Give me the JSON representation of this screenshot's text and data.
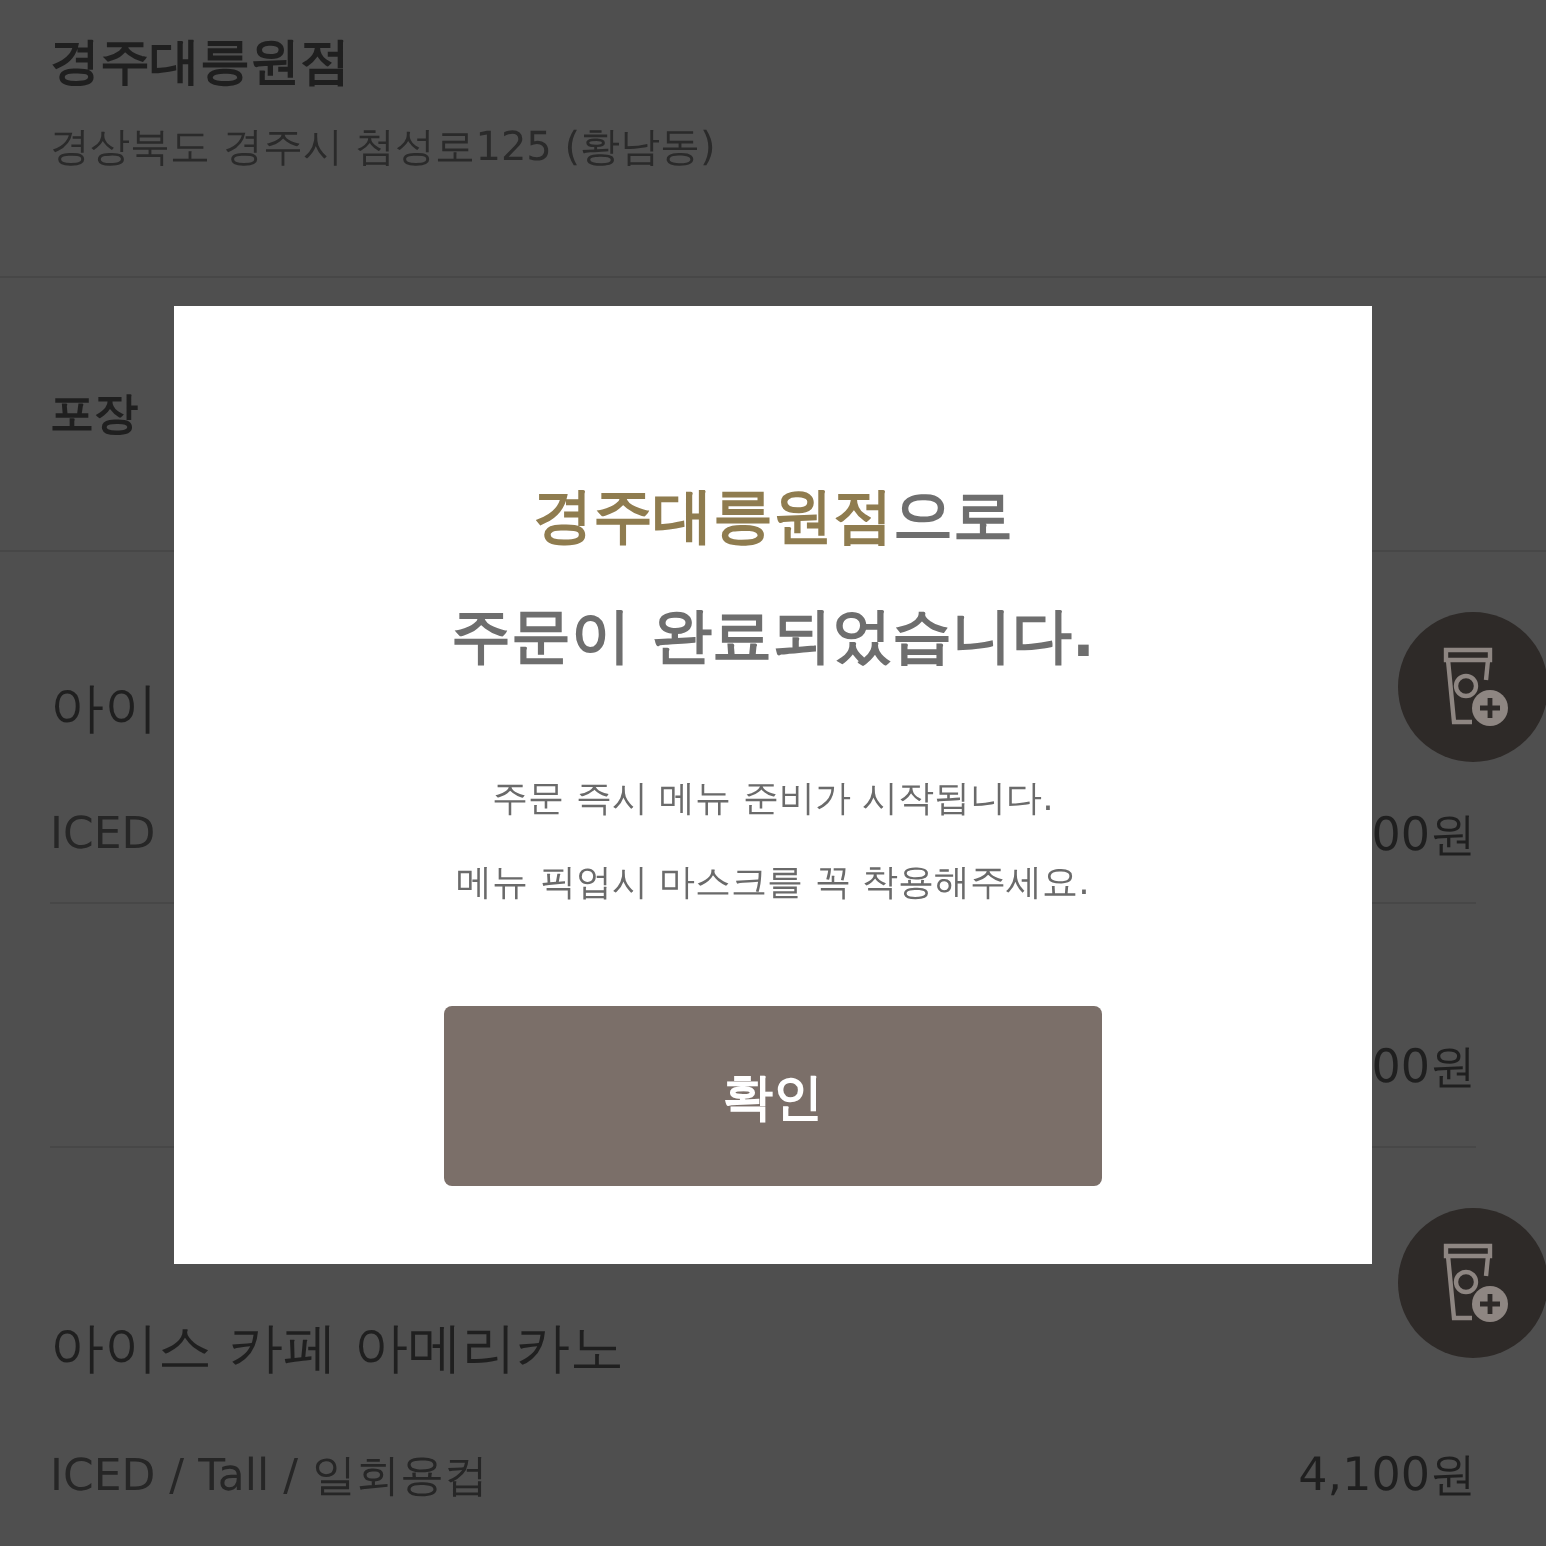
{
  "store": {
    "name": "경주대릉원점",
    "address": "경상북도 경주시 첨성로125 (황남동)"
  },
  "option_row": {
    "label": "포장"
  },
  "items": [
    {
      "name": "아이",
      "options": "ICED",
      "price": "00원",
      "add_button": true
    },
    {
      "price": "00원",
      "add_button": false
    },
    {
      "name": "아이스 카페 아메리카노",
      "options": "ICED / Tall / 일회용컵",
      "price": "4,100원",
      "add_button": true
    }
  ],
  "dialog": {
    "title": {
      "highlight": "경주대릉원점",
      "rest": "으로",
      "second_line": "주문이 완료되었습니다."
    },
    "message": [
      "주문 즉시 메뉴 준비가 시작됩니다.",
      "메뉴 픽업시 마스크를 꼭 착용해주세요."
    ],
    "button": "확인"
  }
}
